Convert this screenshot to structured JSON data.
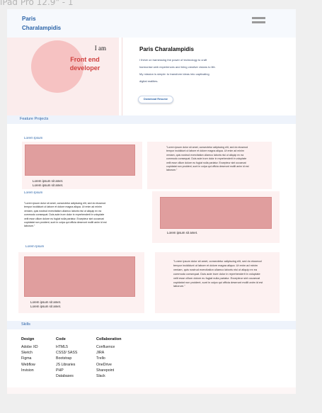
{
  "frame_label": "iPad Pro 12.9\" - 1",
  "header": {
    "brand_line1": "Paris",
    "brand_line2": "Charalampidis",
    "menu_icon": "hamburger-icon"
  },
  "hero": {
    "iam": "I am",
    "role_line1": "Front end",
    "role_line2": "developer",
    "name": "Paris Charalampidis",
    "text": "I thrive on harnessing the power of technology to craft harmonise web experiences and bring creative visions to life. My mission is simple: to transform ideas into captivating digital realities.",
    "download_label": "Download Resume"
  },
  "projects": {
    "section_title": "Feature Projects",
    "items": [
      {
        "heading": "Lorem Ipsum",
        "caption_line1": "Lorem ipsum sit amet.",
        "caption_line2": "Lorem ipsum sit amet.",
        "text": "\"Lorem ipsum dolor sit amet, consectetur adipiscing elit, sed do eiusmod tempor incididunt ut labore et dolore magna aliqua. Ut enim ad minim veniam, quis nostrud exercitation ullamco laboris nisi ut aliquip ex ea commodo consequat. Duis aute irure dolor in reprehenderit in voluptate velit esse cillum dolore eu fugiat nulla pariatur. Excepteur sint occaecat cupidatat non proident, sunt in culpa qui officia deserunt mollit anim id est laborum.\""
      },
      {
        "heading": "Lorem Ipsum",
        "caption_line1": "Lorem ipsum sit amet.",
        "text": "\"Lorem ipsum dolor sit amet, consectetur adipiscing elit, sed do eiusmod tempor incididunt ut labore et dolore magna aliqua. Ut enim ad minim veniam, quis nostrud exercitation ullamco laboris nisi ut aliquip ex ea commodo consequat. Duis aute irure dolor in reprehenderit in voluptate velit esse cillum dolore eu fugiat nulla pariatur. Excepteur sint occaecat cupidatat non proident, sunt in culpa qui officia deserunt mollit anim id est laborum.\""
      },
      {
        "heading": "Lorem Ipsum",
        "caption_line1": "Lorem ipsum sit amet.",
        "caption_line2": "Lorem ipsum sit amet.",
        "text": "\"Lorem ipsum dolor sit amet, consectetur adipiscing elit, sed do eiusmod tempor incididunt ut labore et dolore magna aliqua. Ut enim ad minim veniam, quis nostrud exercitation ullamco laboris nisi ut aliquip ex ea commodo consequat. Duis aute irure dolor in reprehenderit in voluptate velit esse cillum dolore eu fugiat nulla pariatur. Excepteur sint occaecat cupidatat non proident, sunt in culpa qui officia deserunt mollit anim id est laborum.\""
      }
    ]
  },
  "skills": {
    "section_title": "Skills",
    "columns": [
      {
        "heading": "Design",
        "items": [
          "Adobe XD",
          "Sketch",
          "Figma",
          "Webflow",
          "Invision"
        ]
      },
      {
        "heading": "Code",
        "items": [
          "HTML5",
          "CSS3/ SASS",
          "Bootstrap",
          "JS Libraries",
          "PHP",
          "Databases"
        ]
      },
      {
        "heading": "Collaboration",
        "items": [
          "Confluence",
          "JIRA",
          "Trello",
          "OneDrive",
          "Sharepoint",
          "Slack"
        ]
      }
    ]
  },
  "colors": {
    "brand_blue": "#2b64a8",
    "accent_red": "#d0413f",
    "image_pink": "#e09e9e",
    "card_pink": "#fdf1f1"
  }
}
